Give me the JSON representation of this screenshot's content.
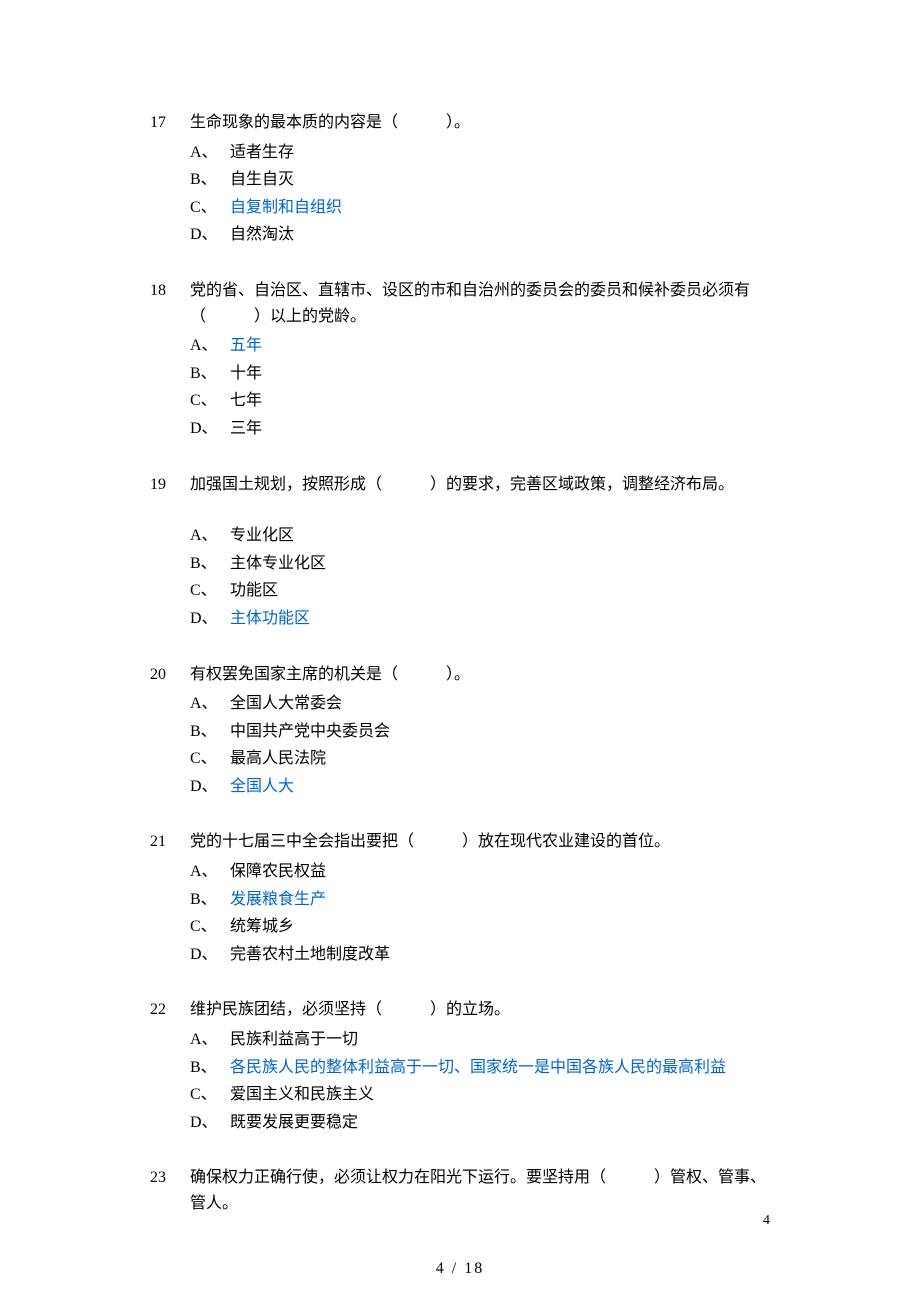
{
  "questions": [
    {
      "number": "17",
      "stem": "生命现象的最本质的内容是（　　　）。",
      "options": [
        {
          "letter": "A、",
          "text": "适者生存",
          "highlighted": false
        },
        {
          "letter": "B、",
          "text": "自生自灭",
          "highlighted": false
        },
        {
          "letter": "C、",
          "text": "自复制和自组织",
          "highlighted": true
        },
        {
          "letter": "D、",
          "text": "自然淘汰",
          "highlighted": false
        }
      ]
    },
    {
      "number": "18",
      "stem": "党的省、自治区、直辖市、设区的市和自治州的委员会的委员和候补委员必须有（　　　）以上的党龄。",
      "options": [
        {
          "letter": "A、",
          "text": "五年",
          "highlighted": true
        },
        {
          "letter": "B、",
          "text": "十年",
          "highlighted": false
        },
        {
          "letter": "C、",
          "text": "七年",
          "highlighted": false
        },
        {
          "letter": "D、",
          "text": "三年",
          "highlighted": false
        }
      ]
    },
    {
      "number": "19",
      "stem": "加强国土规划，按照形成（　　　）的要求，完善区域政策，调整经济布局。",
      "options": [
        {
          "letter": "A、",
          "text": "专业化区",
          "highlighted": false
        },
        {
          "letter": "B、",
          "text": "主体专业化区",
          "highlighted": false
        },
        {
          "letter": "C、",
          "text": "功能区",
          "highlighted": false
        },
        {
          "letter": "D、",
          "text": "主体功能区",
          "highlighted": true
        }
      ]
    },
    {
      "number": "20",
      "stem": "有权罢免国家主席的机关是（　　　）。",
      "options": [
        {
          "letter": "A、",
          "text": "全国人大常委会",
          "highlighted": false
        },
        {
          "letter": "B、",
          "text": "中国共产党中央委员会",
          "highlighted": false
        },
        {
          "letter": "C、",
          "text": "最高人民法院",
          "highlighted": false
        },
        {
          "letter": "D、",
          "text": "全国人大",
          "highlighted": true
        }
      ]
    },
    {
      "number": "21",
      "stem": "党的十七届三中全会指出要把（　　　）放在现代农业建设的首位。",
      "options": [
        {
          "letter": "A、",
          "text": "保障农民权益",
          "highlighted": false
        },
        {
          "letter": "B、",
          "text": "发展粮食生产",
          "highlighted": true
        },
        {
          "letter": "C、",
          "text": "统筹城乡",
          "highlighted": false
        },
        {
          "letter": "D、",
          "text": "完善农村土地制度改革",
          "highlighted": false
        }
      ]
    },
    {
      "number": "22",
      "stem": "维护民族团结，必须坚持（　　　）的立场。",
      "options": [
        {
          "letter": "A、",
          "text": "民族利益高于一切",
          "highlighted": false
        },
        {
          "letter": "B、",
          "text": "各民族人民的整体利益高于一切、国家统一是中国各族人民的最高利益",
          "highlighted": true
        },
        {
          "letter": "C、",
          "text": "爱国主义和民族主义",
          "highlighted": false
        },
        {
          "letter": "D、",
          "text": "既要发展更要稳定",
          "highlighted": false
        }
      ]
    },
    {
      "number": "23",
      "stem": "确保权力正确行使，必须让权力在阳光下运行。要坚持用（　　　）管权、管事、管人。",
      "options": []
    }
  ],
  "corner_page_number": "4",
  "footer_page": "4  /  18",
  "q19_extra_spacing": true
}
